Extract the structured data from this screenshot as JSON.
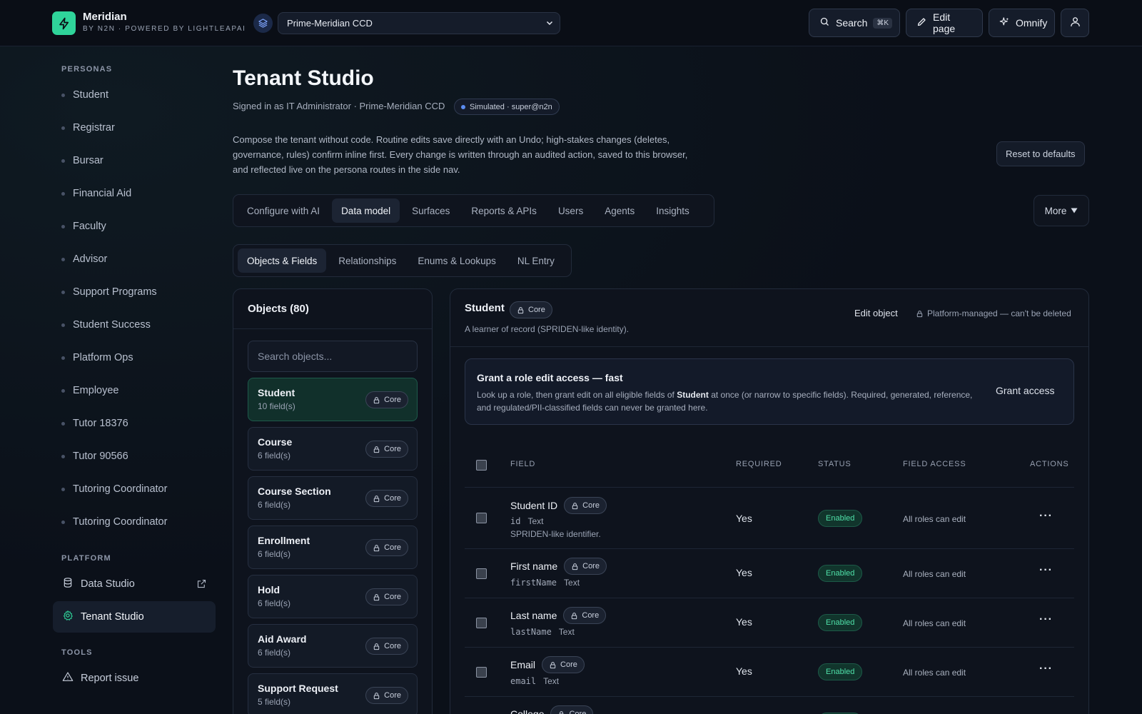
{
  "app": {
    "name": "Meridian",
    "subtitle": "BY N2N · POWERED BY LIGHTLEAPAI",
    "tenant": "Prime-Meridian CCD"
  },
  "topbar": {
    "search_label": "Search",
    "search_shortcut": "⌘K",
    "edit_label": "Edit page",
    "omnify_label": "Omnify"
  },
  "sidebar": {
    "personas_label": "PERSONAS",
    "personas": [
      "Student",
      "Registrar",
      "Bursar",
      "Financial Aid",
      "Faculty",
      "Advisor",
      "Support Programs",
      "Student Success",
      "Platform Ops",
      "Employee",
      "Tutor 18376",
      "Tutor 90566",
      "Tutoring Coordinator",
      "Tutoring Coordinator"
    ],
    "platform_label": "PLATFORM",
    "data_studio": "Data Studio",
    "tenant_studio": "Tenant Studio",
    "tools_label": "TOOLS",
    "report_issue": "Report issue"
  },
  "page": {
    "title": "Tenant Studio",
    "signed_in": "Signed in as IT Administrator · Prime-Meridian CCD",
    "simulated": "Simulated · super@n2n",
    "description": "Compose the tenant without code. Routine edits save directly with an Undo; high-stakes changes (deletes, governance, rules) confirm inline first. Every change is written through an audited action, saved to this browser, and reflected live on the persona routes in the side nav.",
    "reset_label": "Reset to defaults",
    "tabs": [
      "Configure with AI",
      "Data model",
      "Surfaces",
      "Reports & APIs",
      "Users",
      "Agents",
      "Insights"
    ],
    "active_tab": "Data model",
    "more_label": "More",
    "subtabs": [
      "Objects & Fields",
      "Relationships",
      "Enums & Lookups",
      "NL Entry"
    ],
    "active_subtab": "Objects & Fields"
  },
  "objects": {
    "title": "Objects (80)",
    "search_placeholder": "Search objects...",
    "core_label": "Core",
    "items": [
      {
        "name": "Student",
        "count": "10 field(s)"
      },
      {
        "name": "Course",
        "count": "6 field(s)"
      },
      {
        "name": "Course Section",
        "count": "6 field(s)"
      },
      {
        "name": "Enrollment",
        "count": "6 field(s)"
      },
      {
        "name": "Hold",
        "count": "6 field(s)"
      },
      {
        "name": "Aid Award",
        "count": "6 field(s)"
      },
      {
        "name": "Support Request",
        "count": "5 field(s)"
      }
    ]
  },
  "detail": {
    "title": "Student",
    "core_label": "Core",
    "description": "A learner of record (SPRIDEN-like identity).",
    "edit_object": "Edit object",
    "platform_note": "Platform-managed — can't be deleted",
    "grant": {
      "title": "Grant a role edit access — fast",
      "desc_pre": "Look up a role, then grant edit on all eligible fields of ",
      "desc_obj": "Student",
      "desc_post": " at once (or narrow to specific fields). Required, generated, reference, and regulated/PII-classified fields can never be granted here.",
      "button": "Grant access"
    },
    "columns": {
      "field": "FIELD",
      "required": "REQUIRED",
      "status": "STATUS",
      "access": "FIELD ACCESS",
      "actions": "ACTIONS"
    },
    "rows": [
      {
        "name": "Student ID",
        "key": "id",
        "type": "Text",
        "note": "SPRIDEN-like identifier.",
        "required": "Yes",
        "status": "Enabled",
        "access": "All roles can edit"
      },
      {
        "name": "First name",
        "key": "firstName",
        "type": "Text",
        "note": "",
        "required": "Yes",
        "status": "Enabled",
        "access": "All roles can edit"
      },
      {
        "name": "Last name",
        "key": "lastName",
        "type": "Text",
        "note": "",
        "required": "Yes",
        "status": "Enabled",
        "access": "All roles can edit"
      },
      {
        "name": "Email",
        "key": "email",
        "type": "Text",
        "note": "",
        "required": "Yes",
        "status": "Enabled",
        "access": "All roles can edit"
      },
      {
        "name": "College",
        "key": "",
        "type": "",
        "note": "",
        "required": "",
        "status": "",
        "access": ""
      }
    ]
  },
  "colors": {
    "accent": "#2fd49a",
    "enabled": "#4fe0a8",
    "info": "#5b8cf0"
  }
}
